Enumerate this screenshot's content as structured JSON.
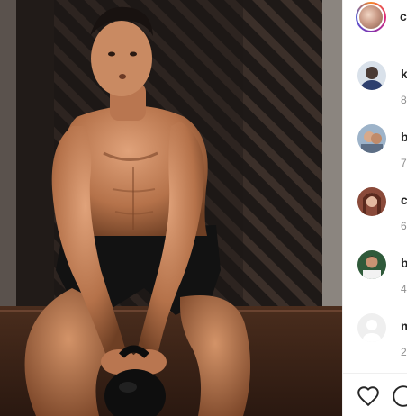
{
  "post": {
    "author": {
      "username_visible": "c"
    }
  },
  "comments": [
    {
      "username_visible": "k",
      "time_visible": "8"
    },
    {
      "username_visible": "b",
      "time_visible": "7"
    },
    {
      "username_visible": "c",
      "time_visible": "6"
    },
    {
      "username_visible": "b",
      "time_visible": "4"
    },
    {
      "username_visible": "m",
      "time_visible": "2"
    }
  ],
  "actions": {
    "like_icon": "heart-icon",
    "comment_icon": "comment-icon"
  },
  "colors": {
    "photo_background": "#1a1513",
    "skin_tone": "#c8845a",
    "shorts": "#111111",
    "floor": "#3a2418",
    "text_primary": "#262626",
    "text_secondary": "#8e8e8e",
    "divider": "#efefef"
  }
}
